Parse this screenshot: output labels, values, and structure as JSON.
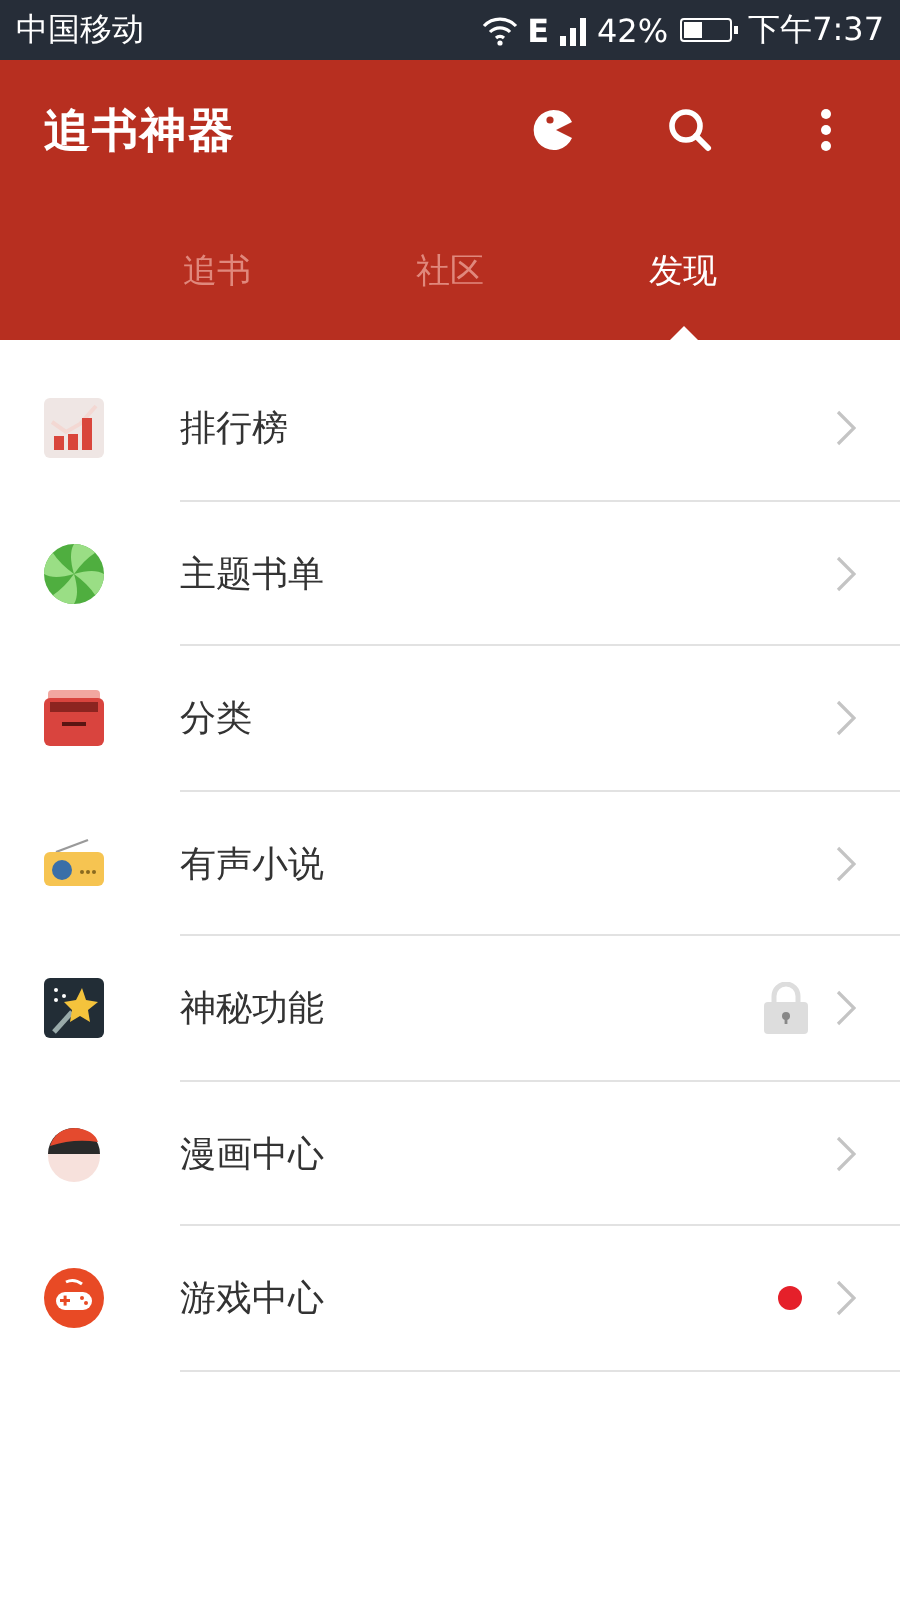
{
  "status_bar": {
    "carrier": "中国移动",
    "network_type": "E",
    "battery_percent": "42%",
    "time": "下午7:37"
  },
  "app_bar": {
    "title": "追书神器"
  },
  "tabs": [
    {
      "label": "追书",
      "selected": false
    },
    {
      "label": "社区",
      "selected": false
    },
    {
      "label": "发现",
      "selected": true
    }
  ],
  "menu_items": [
    {
      "kind": "chart",
      "label": "排行榜",
      "locked": false,
      "new_dot": false
    },
    {
      "kind": "candy",
      "label": "主题书单",
      "locked": false,
      "new_dot": false
    },
    {
      "kind": "drawer",
      "label": "分类",
      "locked": false,
      "new_dot": false
    },
    {
      "kind": "radio",
      "label": "有声小说",
      "locked": false,
      "new_dot": false
    },
    {
      "kind": "wand",
      "label": "神秘功能",
      "locked": true,
      "new_dot": false
    },
    {
      "kind": "face",
      "label": "漫画中心",
      "locked": false,
      "new_dot": false
    },
    {
      "kind": "gamepad",
      "label": "游戏中心",
      "locked": false,
      "new_dot": true
    }
  ]
}
